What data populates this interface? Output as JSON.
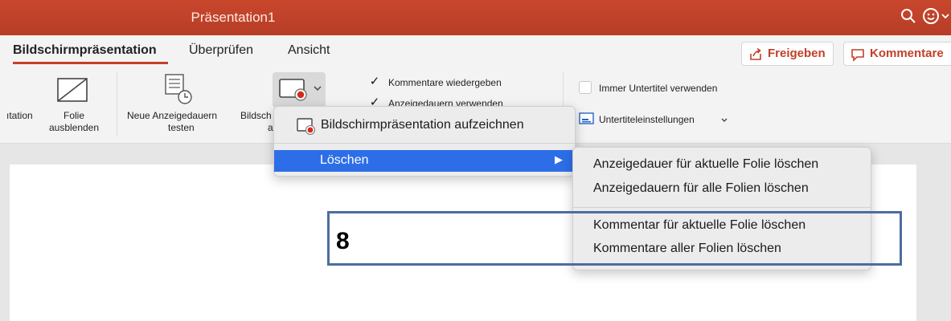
{
  "window": {
    "title": "Präsentation1"
  },
  "tabs": [
    {
      "label": "Bildschirmpräsentation",
      "active": true
    },
    {
      "label": "Überprüfen",
      "active": false
    },
    {
      "label": "Ansicht",
      "active": false
    }
  ],
  "actions": {
    "share": "Freigeben",
    "comments": "Kommentare"
  },
  "ribbon": {
    "partial_left": "ıtation",
    "hide_slide": [
      "Folie",
      "ausblenden"
    ],
    "rehearse": [
      "Neue Anzeigedauern",
      "testen"
    ],
    "record_partial": [
      "Bildsch",
      "a"
    ],
    "checks": [
      {
        "label": "Kommentare wiedergeben",
        "checked": true
      },
      {
        "label": "Anzeigedauern verwenden",
        "checked": true
      }
    ],
    "subtitles_always": {
      "label": "Immer Untertitel verwenden",
      "checked": false
    },
    "subtitle_settings": "Untertiteleinstellungen"
  },
  "record_menu": {
    "record": "Bildschirmpräsentation aufzeichnen",
    "delete": "Löschen",
    "arrow": "▶"
  },
  "delete_submenu": [
    "Anzeigedauer für aktuelle Folie löschen",
    "Anzeigedauern für alle Folien löschen",
    "Kommentar für aktuelle Folie löschen",
    "Kommentare aller Folien löschen"
  ],
  "annotation": {
    "number": "8",
    "color": "#4c6d9f"
  },
  "colors": {
    "titlebar": "#c23f27",
    "accent": "#c23f27",
    "highlight": "#2d6ee8"
  }
}
